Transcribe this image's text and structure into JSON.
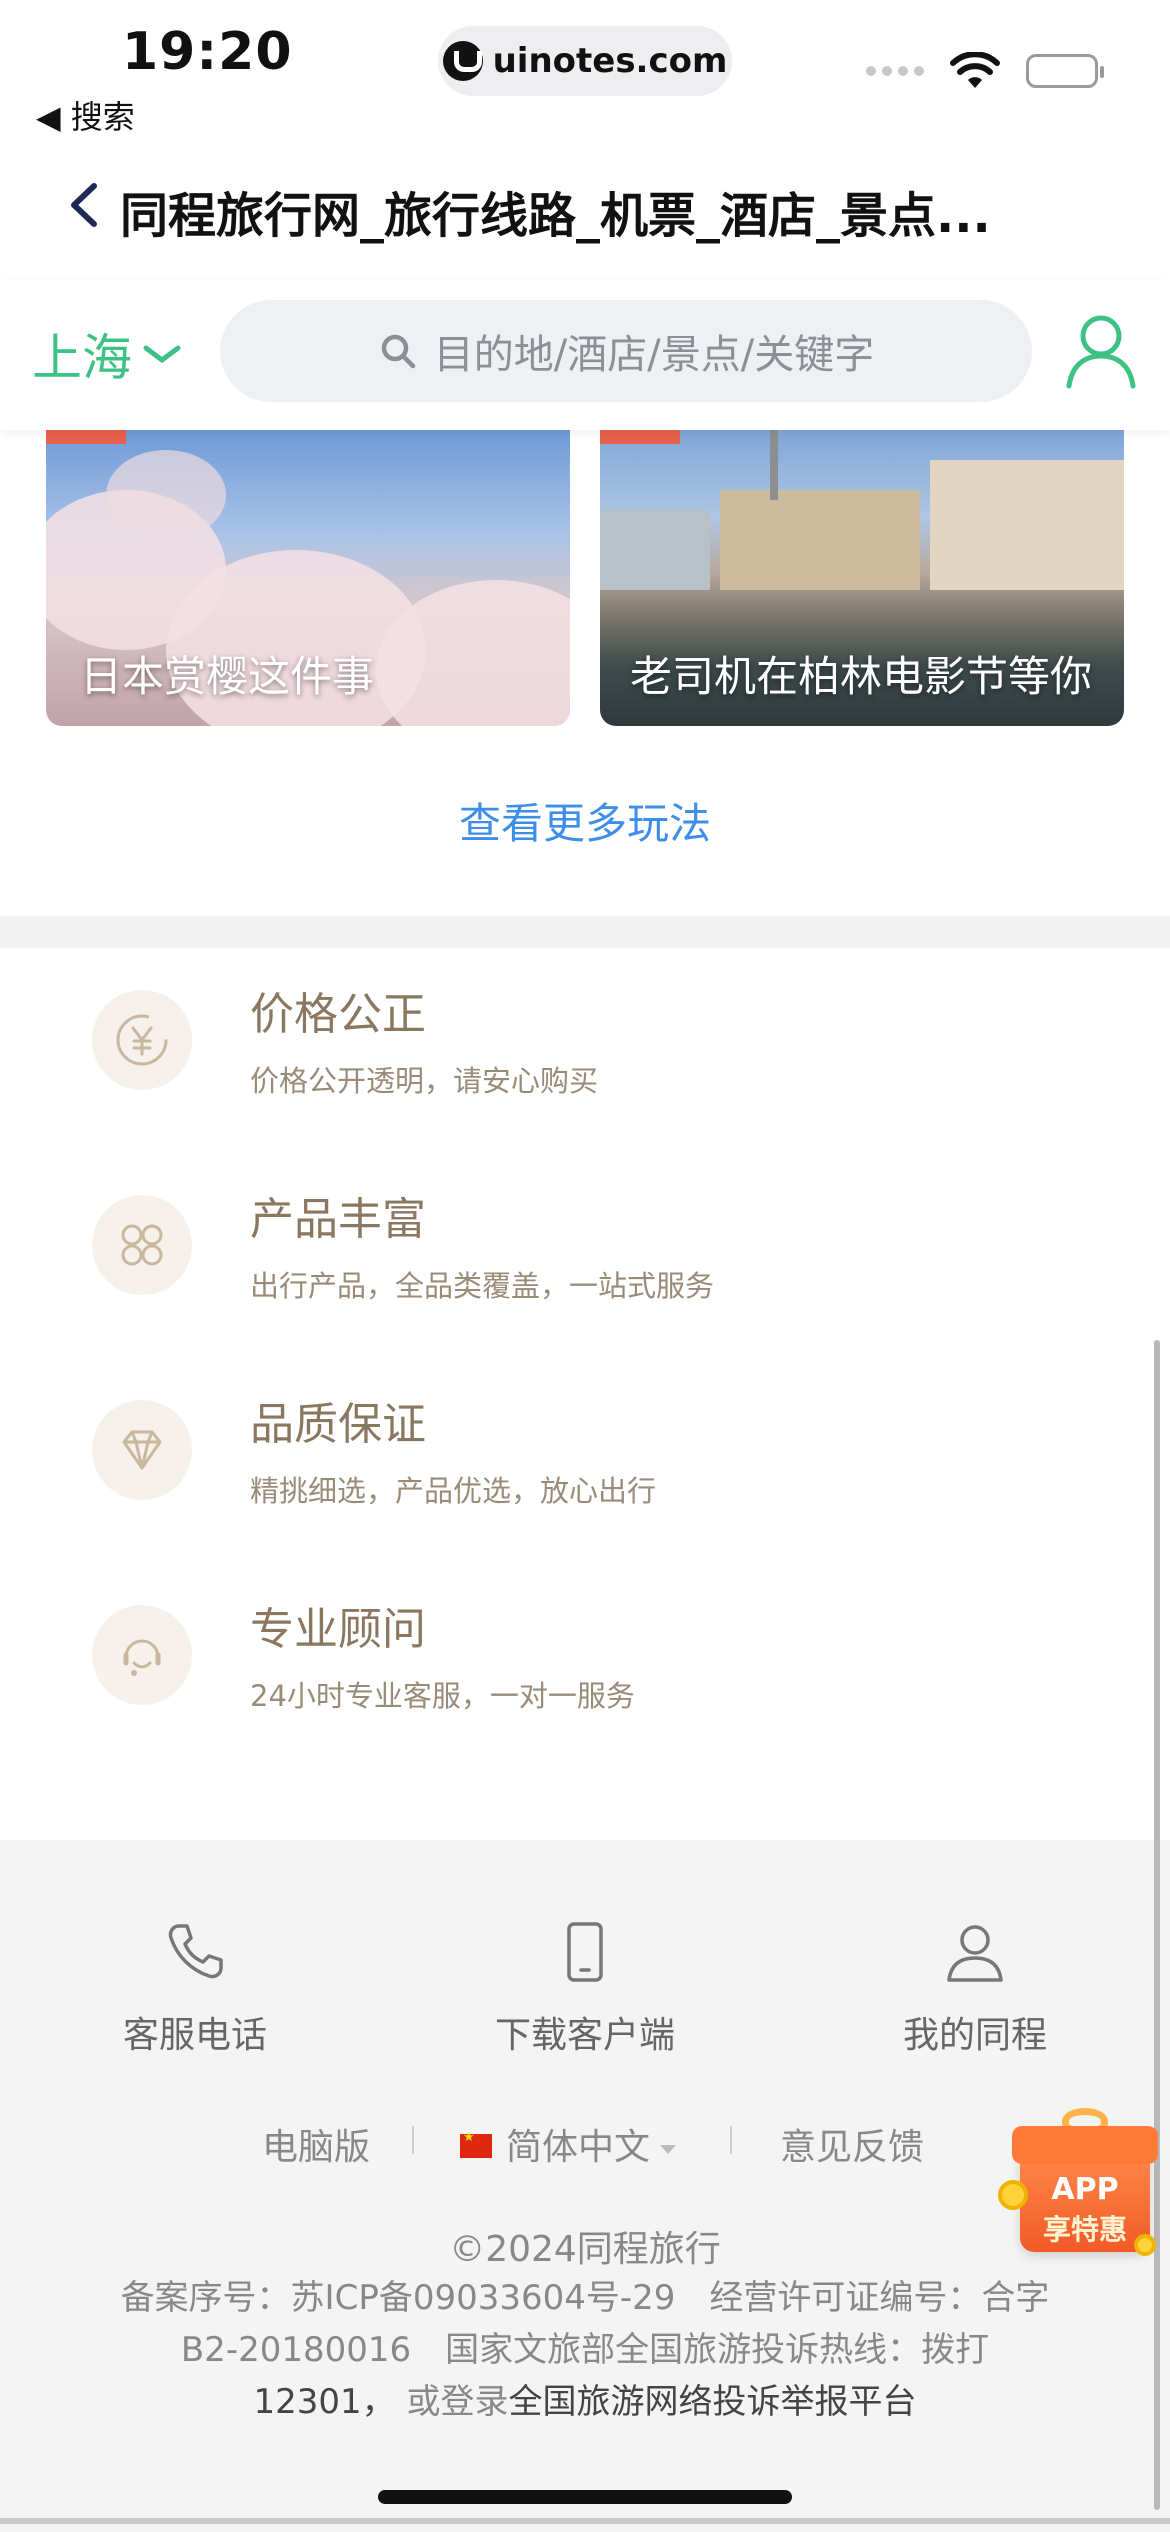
{
  "status_bar": {
    "time": "19:20",
    "back_app": "◀ 搜索",
    "url": "uinotes.com"
  },
  "browser": {
    "page_title": "同程旅行网_旅行线路_机票_酒店_景点..."
  },
  "header": {
    "city": "上海",
    "search_placeholder": "目的地/酒店/景点/关键字"
  },
  "cards": [
    {
      "caption": "日本赏樱这件事"
    },
    {
      "caption": "老司机在柏林电影节等你"
    }
  ],
  "more_link": "查看更多玩法",
  "features": [
    {
      "title": "价格公正",
      "desc": "价格公开透明，请安心购买",
      "icon": "yen-icon"
    },
    {
      "title": "产品丰富",
      "desc": "出行产品，全品类覆盖，一站式服务",
      "icon": "grid-icon"
    },
    {
      "title": "品质保证",
      "desc": "精挑细选，产品优选，放心出行",
      "icon": "diamond-icon"
    },
    {
      "title": "专业顾问",
      "desc": "24小时专业客服，一对一服务",
      "icon": "headset-icon"
    }
  ],
  "footer": {
    "nav": [
      {
        "label": "客服电话",
        "icon": "phone-icon"
      },
      {
        "label": "下载客户端",
        "icon": "mobile-icon"
      },
      {
        "label": "我的同程",
        "icon": "user-icon"
      }
    ],
    "links": {
      "desktop": "电脑版",
      "language": "简体中文",
      "feedback": "意见反馈"
    },
    "copyright": "©2024同程旅行",
    "icp_line1": "备案序号：苏ICP备09033604号-29　经营许可证编号：合字",
    "icp_line2": "B2-20180016　国家文旅部全国旅游投诉热线：拨打",
    "icp_line3_a": "12301，",
    "icp_line3_b": "或登录",
    "icp_line3_c": "全国旅游网络投诉举报平台"
  },
  "app_badge": {
    "line1": "APP",
    "line2": "享特惠"
  },
  "colors": {
    "brand_green": "#3cc284",
    "link_blue": "#3d8ee8",
    "feature_brown": "#8a7760",
    "badge_orange": "#f25a28"
  }
}
